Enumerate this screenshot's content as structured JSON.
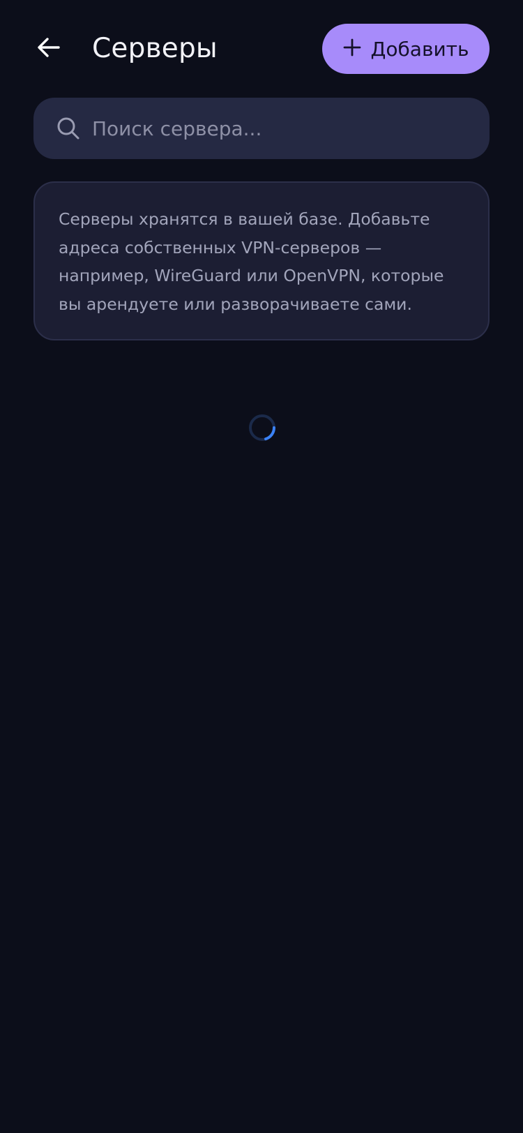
{
  "header": {
    "title": "Серверы",
    "back_icon": "arrow-left-icon",
    "add_button": {
      "label": "Добавить",
      "icon": "plus-icon"
    }
  },
  "search": {
    "value": "",
    "placeholder": "Поиск сервера...",
    "icon": "search-icon"
  },
  "info": {
    "text": "Серверы хранятся в вашей базе. Добавьте адреса собственных VPN-серверов — например, WireGuard или OpenVPN, которые вы арендуете или разворачиваете сами."
  },
  "loading": {
    "icon": "loading-spinner-icon"
  },
  "colors": {
    "background": "#0c0e1a",
    "accent": "#a78bfa",
    "search_bg": "#252943",
    "card_bg": "#1c1e33",
    "spinner": "#3b82f6"
  }
}
